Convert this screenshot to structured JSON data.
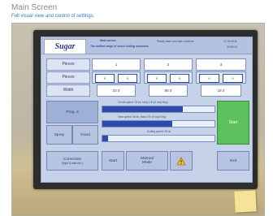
{
  "caption": {
    "title": "Main Screen",
    "subtitle": "Full visual view and control of settings."
  },
  "hmi": {
    "logo_text": "Sugar",
    "header": {
      "screen_name": "Main screen",
      "subtitle": "The unified range of board cutting machines",
      "status": "Ready state and safe machine",
      "date": "17.06.2011",
      "time": "09:53:19"
    },
    "grid": {
      "pieces_label": "Pieces",
      "pieces_values": [
        "1",
        "2",
        "3"
      ],
      "pieces_count_label": "Pieces",
      "pieces_counts": [
        {
          "a": "0",
          "b": "0"
        },
        {
          "a": "0",
          "b": "0"
        },
        {
          "a": "0",
          "b": "0"
        }
      ],
      "width_label": "Width",
      "widths": [
        "33 0",
        "88 0",
        "18 0"
      ]
    },
    "controls": {
      "program_label": "Prog. 4",
      "spray_label": "Spray",
      "good_label": "Good",
      "correction_label": "Correction",
      "correction_sublabel": "(right & saw etc.)",
      "start_label": "Start",
      "manual_label": "Manual",
      "manual_sublabel": "Mode",
      "go_label": "Start",
      "exit_label": "Exit"
    },
    "speeds": [
      {
        "label": "Chunk speed: 33 sb, body 0 th (0 ooly 0/hy)",
        "level": 0.72
      },
      {
        "label": "Infos speed: 36 sb, body 0 th (0 ooly 0/hy)",
        "level": 0.62
      },
      {
        "label": "Cutting speed: 33 sb",
        "level": 0.05
      }
    ]
  }
}
